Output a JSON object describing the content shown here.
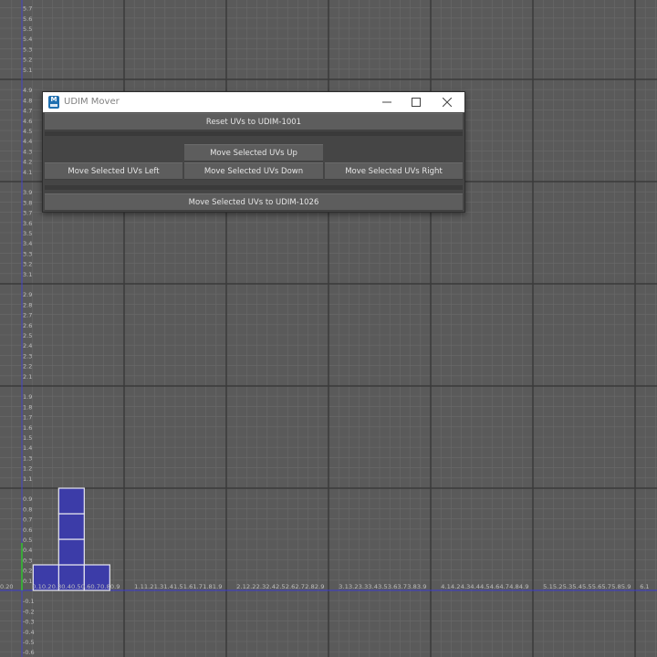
{
  "window": {
    "title": "UDIM Mover",
    "icon": "maya-app-icon",
    "icon_letter": "M",
    "controls": [
      "minimize-icon",
      "maximize-icon",
      "close-icon"
    ],
    "buttons": {
      "reset": "Reset UVs to UDIM-1001",
      "up": "Move Selected UVs Up",
      "left": "Move Selected UVs Left",
      "down": "Move Selected UVs Down",
      "right": "Move Selected UVs Right",
      "to_1026": "Move Selected UVs to UDIM-1026"
    }
  },
  "uv_editor": {
    "background_color": "#5a5a5a",
    "grid_color": "#6a6a6a",
    "udim_line_color": "#3a3a3a",
    "u_axis_color": "#3a3ad0",
    "v_axis_color": "#3aa83a",
    "uv_shell_color": "#3c3ca8",
    "v_labels": {
      "top": [
        "5.7",
        "5.6",
        "5.5",
        "5.4",
        "5.3",
        "5.2",
        "5.1"
      ],
      "band4": [
        "4.9",
        "4.8",
        "4.7",
        "4.6",
        "4.5",
        "4.4",
        "4.3",
        "4.2",
        "4.1"
      ],
      "band3": [
        "3.9",
        "3.8",
        "3.7",
        "3.6",
        "3.5",
        "3.4",
        "3.3",
        "3.2",
        "3.1"
      ],
      "band2": [
        "2.9",
        "2.8",
        "2.7",
        "2.6",
        "2.5",
        "2.4",
        "2.3",
        "2.2",
        "2.1"
      ],
      "band1": [
        "1.9",
        "1.8",
        "1.7",
        "1.6",
        "1.5",
        "1.4",
        "1.3",
        "1.2",
        "1.1"
      ],
      "band0": [
        "0.9",
        "0.8",
        "0.7",
        "0.6",
        "0.5",
        "0.4",
        "0.3",
        "0.2",
        "0.1"
      ],
      "negative": [
        "-0.1",
        "-0.2",
        "-0.3",
        "-0.4",
        "-0.5",
        "-0.6"
      ]
    },
    "u_labels": {
      "start": "0.20",
      "band0": "0.10.20.30.40.50.60.70.80.9",
      "band1": "1.11.21.31.41.51.61.71.81.9",
      "band2": "2.12.22.32.42.52.62.72.82.9",
      "band3": "3.13.23.33.43.53.63.73.83.9",
      "band4": "4.14.24.34.44.54.64.74.84.9",
      "band5": "5.15.25.35.45.55.65.75.85.9",
      "band6": "6.1"
    }
  }
}
